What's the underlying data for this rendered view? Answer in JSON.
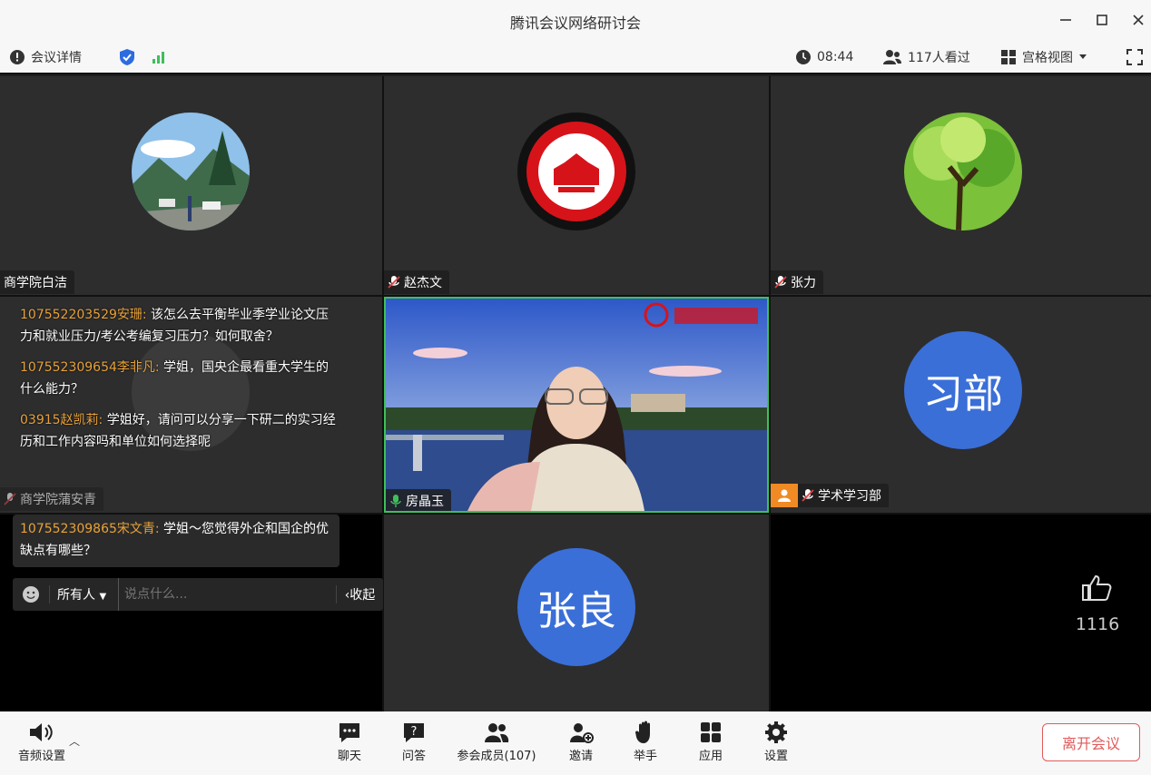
{
  "window": {
    "title": "腾讯会议网络研讨会"
  },
  "toolbar": {
    "meeting_details": "会议详情",
    "timer": "08:44",
    "viewers": "117人看过",
    "view_mode": "宫格视图"
  },
  "tiles": {
    "t1_name": "商学院白洁",
    "t2_name": "赵杰文",
    "t3_name": "张力",
    "t4_name": "商学院蒲安青",
    "t5_name": "房晶玉",
    "t6_name": "学术学习部",
    "t6_initials": "习部",
    "t8_initials": "张良"
  },
  "chat": {
    "messages": [
      {
        "who": "107552203529安珊:",
        "text": " 该怎么去平衡毕业季学业论文压力和就业压力/考公考编复习压力？如何取舍？"
      },
      {
        "who": "107552309654李非凡:",
        "text": " 学姐，国央企最看重大学生的什么能力？"
      },
      {
        "who": "03915赵凯莉:",
        "text": " 学姐好，请问可以分享一下研二的实习经历和工作内容吗和单位如何选择呢"
      },
      {
        "who": "107552309865宋文青:",
        "text": " 学姐～您觉得外企和国企的优缺点有哪些？"
      }
    ],
    "recipient": "所有人",
    "placeholder": "说点什么...",
    "collapse": "收起"
  },
  "likes": {
    "count": "1116"
  },
  "bottombar": {
    "audio_settings": "音频设置",
    "chat": "聊天",
    "qa": "问答",
    "participants": "参会成员(107)",
    "invite": "邀请",
    "raise_hand": "举手",
    "apps": "应用",
    "settings": "设置",
    "leave": "离开会议"
  },
  "colors": {
    "accent": "#3a6fd8",
    "leave": "#e25a5a",
    "active_border": "#3fbf5a",
    "chat_name": "#e8a23a"
  }
}
